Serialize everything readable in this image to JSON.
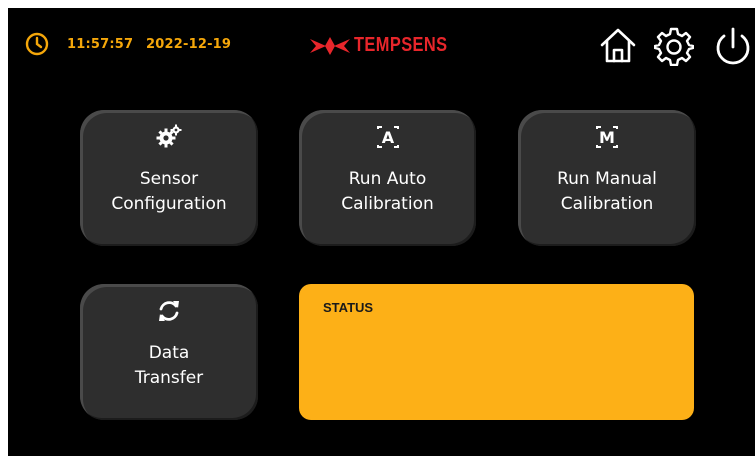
{
  "header": {
    "time": "11:57:57",
    "date": "2022-12-19",
    "brand": "TEMPSENS",
    "icons": {
      "clock": "clock-icon",
      "home": "home-icon",
      "settings": "gear-icon",
      "power": "power-icon"
    }
  },
  "tiles": [
    {
      "label_line1": "Sensor",
      "label_line2": "Configuration",
      "icon": "gears-icon"
    },
    {
      "label_line1": "Run Auto",
      "label_line2": "Calibration",
      "icon_text": "A"
    },
    {
      "label_line1": "Run Manual",
      "label_line2": "Calibration",
      "icon_text": "M"
    },
    {
      "label_line1": "Data",
      "label_line2": "Transfer",
      "icon": "sync-icon"
    }
  ],
  "status": {
    "title": "STATUS",
    "text": ""
  },
  "colors": {
    "accent": "#f5a70a",
    "brand": "#e8262b",
    "tile": "#2e2e2e",
    "status_panel": "#fdb017",
    "background": "#000000"
  }
}
